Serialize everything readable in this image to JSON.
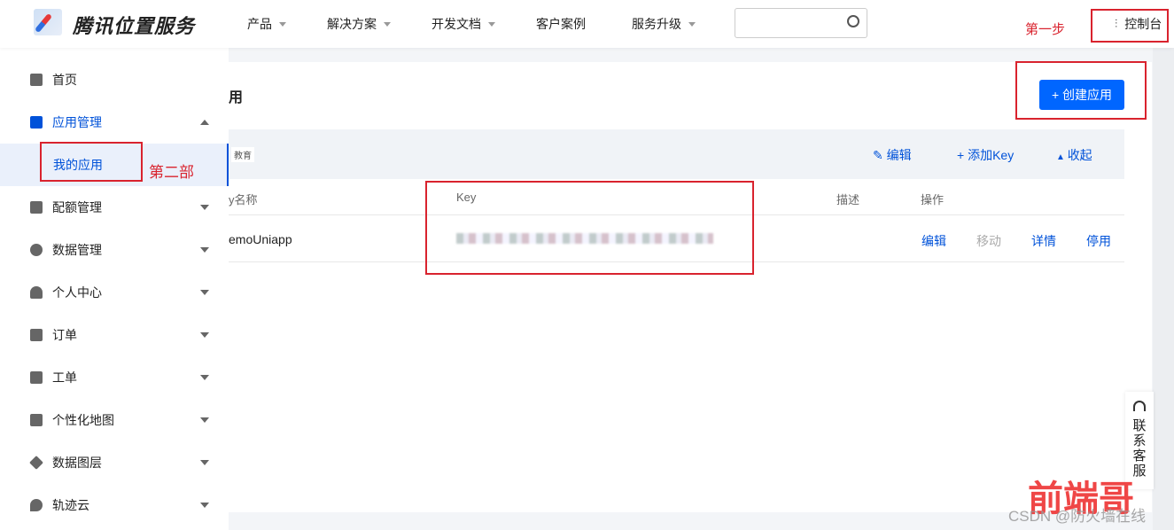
{
  "header": {
    "brand": "腾讯位置服务",
    "nav": [
      {
        "label": "产品",
        "dropdown": true
      },
      {
        "label": "解决方案",
        "dropdown": true
      },
      {
        "label": "开发文档",
        "dropdown": true
      },
      {
        "label": "客户案例",
        "dropdown": false
      },
      {
        "label": "服务升级",
        "dropdown": true
      }
    ],
    "search_placeholder": "",
    "console": "控制台"
  },
  "sidebar": {
    "items": [
      {
        "label": "首页"
      },
      {
        "label": "应用管理",
        "expanded": true
      },
      {
        "label": "我的应用",
        "selected": true
      },
      {
        "label": "配额管理"
      },
      {
        "label": "数据管理"
      },
      {
        "label": "个人中心"
      },
      {
        "label": "订单"
      },
      {
        "label": "工单"
      },
      {
        "label": "个性化地图"
      },
      {
        "label": "数据图层"
      },
      {
        "label": "轨迹云"
      }
    ]
  },
  "main": {
    "title_partial": "用",
    "create_button": "+ 创建应用",
    "app": {
      "tag": "教育",
      "actions": {
        "edit": "编辑",
        "add_key": "添加Key",
        "collapse": "收起"
      }
    },
    "table": {
      "headers": [
        "y名称",
        "Key",
        "描述",
        "操作"
      ],
      "rows": [
        {
          "name": "emoUniapp",
          "key": "[blurred]",
          "desc": "",
          "ops": [
            "编辑",
            "移动",
            "详情",
            "停用"
          ]
        }
      ]
    }
  },
  "annotations": {
    "step1": "第一步",
    "step2": "第二部"
  },
  "support": "联系客服",
  "watermark": {
    "logo": "前端哥",
    "text": "CSDN @防火墙在线"
  },
  "colors": {
    "accent": "#0052d9",
    "annotation": "#d9232e"
  }
}
